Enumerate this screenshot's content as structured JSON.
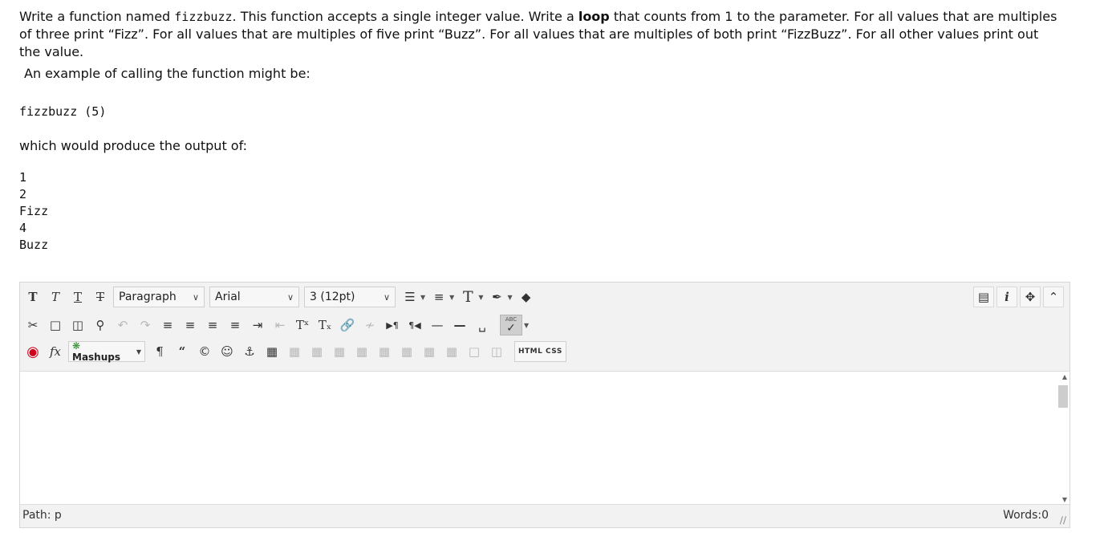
{
  "question": {
    "intro_1": "Write a function named ",
    "func_name": "fizzbuzz",
    "intro_2": ". This function accepts a single integer value. Write a ",
    "loop_word": "loop",
    "intro_3": " that counts from 1 to the parameter. For all values that are multiples of three print “Fizz”. For all values that are multiples of five print “Buzz”. For all values that are multiples of both print “FizzBuzz”. For all other values print out the value.",
    "example_label": "An example of calling the function might be:",
    "example_call": "fizzbuzz (5)",
    "output_label": "which would produce the output of:",
    "output_lines": [
      "1",
      "2",
      "Fizz",
      "4",
      "Buzz"
    ]
  },
  "editor": {
    "toolbar": {
      "paragraph_select": "Paragraph",
      "font_select": "Arial",
      "size_select": "3 (12pt)",
      "mashups_label": "Mashups",
      "html_css_label": "HTML CSS",
      "spellcheck_abc": "ABC"
    },
    "status": {
      "path": "Path: p",
      "words": "Words:0"
    }
  }
}
